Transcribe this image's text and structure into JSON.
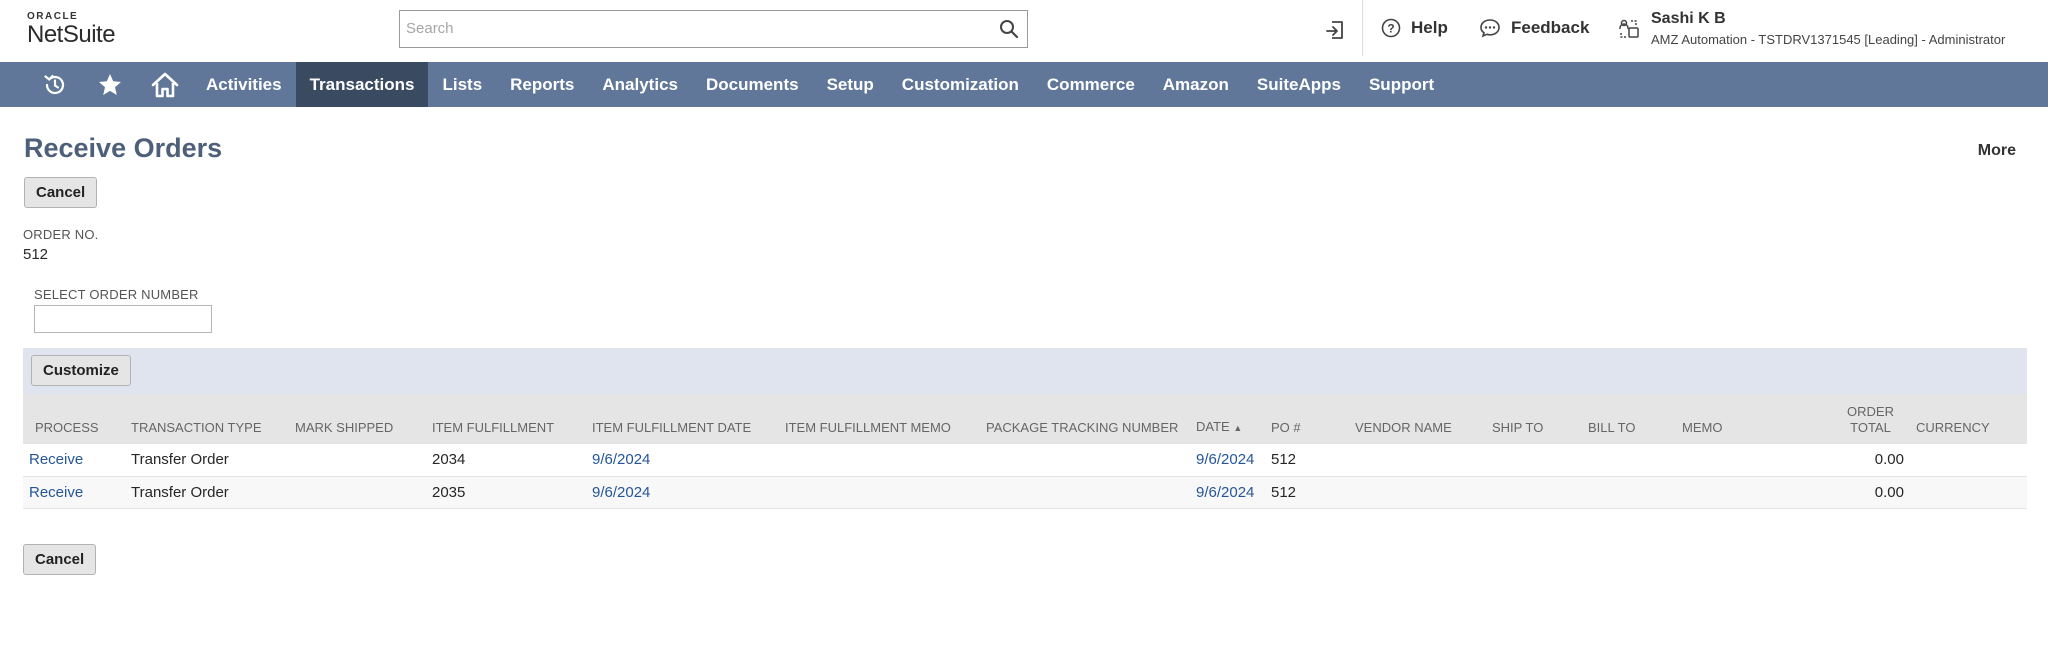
{
  "brand": {
    "oracle": "ORACLE",
    "netsuite": "NetSuite"
  },
  "search": {
    "placeholder": "Search",
    "value": ""
  },
  "header": {
    "help": "Help",
    "feedback": "Feedback",
    "user_name": "Sashi K B",
    "user_role": "AMZ Automation - TSTDRV1371545 [Leading] - Administrator"
  },
  "nav": {
    "items": [
      "Activities",
      "Transactions",
      "Lists",
      "Reports",
      "Analytics",
      "Documents",
      "Setup",
      "Customization",
      "Commerce",
      "Amazon",
      "SuiteApps",
      "Support"
    ],
    "active": "Transactions"
  },
  "page": {
    "title": "Receive Orders",
    "more": "More",
    "cancel_top": "Cancel",
    "cancel_bottom": "Cancel",
    "order_no_label": "ORDER NO.",
    "order_no_value": "512",
    "select_order_label": "SELECT ORDER NUMBER",
    "select_order_value": "",
    "customize": "Customize"
  },
  "table": {
    "headers": {
      "process": "PROCESS",
      "transaction_type": "TRANSACTION TYPE",
      "mark_shipped": "MARK SHIPPED",
      "item_fulfillment": "ITEM FULFILLMENT",
      "item_fulfillment_date": "ITEM FULFILLMENT DATE",
      "item_fulfillment_memo": "ITEM FULFILLMENT MEMO",
      "package_tracking_number": "PACKAGE TRACKING NUMBER",
      "date": "DATE",
      "po": "PO #",
      "vendor_name": "VENDOR NAME",
      "ship_to": "SHIP TO",
      "bill_to": "BILL TO",
      "memo": "MEMO",
      "order_total_1": "ORDER",
      "order_total_2": "TOTAL",
      "currency": "CURRENCY"
    },
    "rows": [
      {
        "process": "Receive",
        "transaction_type": "Transfer Order",
        "mark_shipped": "",
        "item_fulfillment": "2034",
        "item_fulfillment_date": "9/6/2024",
        "item_fulfillment_memo": "",
        "package_tracking_number": "",
        "date": "9/6/2024",
        "po": "512",
        "vendor_name": "",
        "ship_to": "",
        "bill_to": "",
        "memo": "",
        "order_total": "0.00",
        "currency": ""
      },
      {
        "process": "Receive",
        "transaction_type": "Transfer Order",
        "mark_shipped": "",
        "item_fulfillment": "2035",
        "item_fulfillment_date": "9/6/2024",
        "item_fulfillment_memo": "",
        "package_tracking_number": "",
        "date": "9/6/2024",
        "po": "512",
        "vendor_name": "",
        "ship_to": "",
        "bill_to": "",
        "memo": "",
        "order_total": "0.00",
        "currency": ""
      }
    ]
  },
  "colors": {
    "nav_bg": "#607799",
    "nav_active": "#3a4a60",
    "title": "#4d5f79",
    "link": "#255599",
    "toolbar_bg": "#e0e4ee"
  }
}
